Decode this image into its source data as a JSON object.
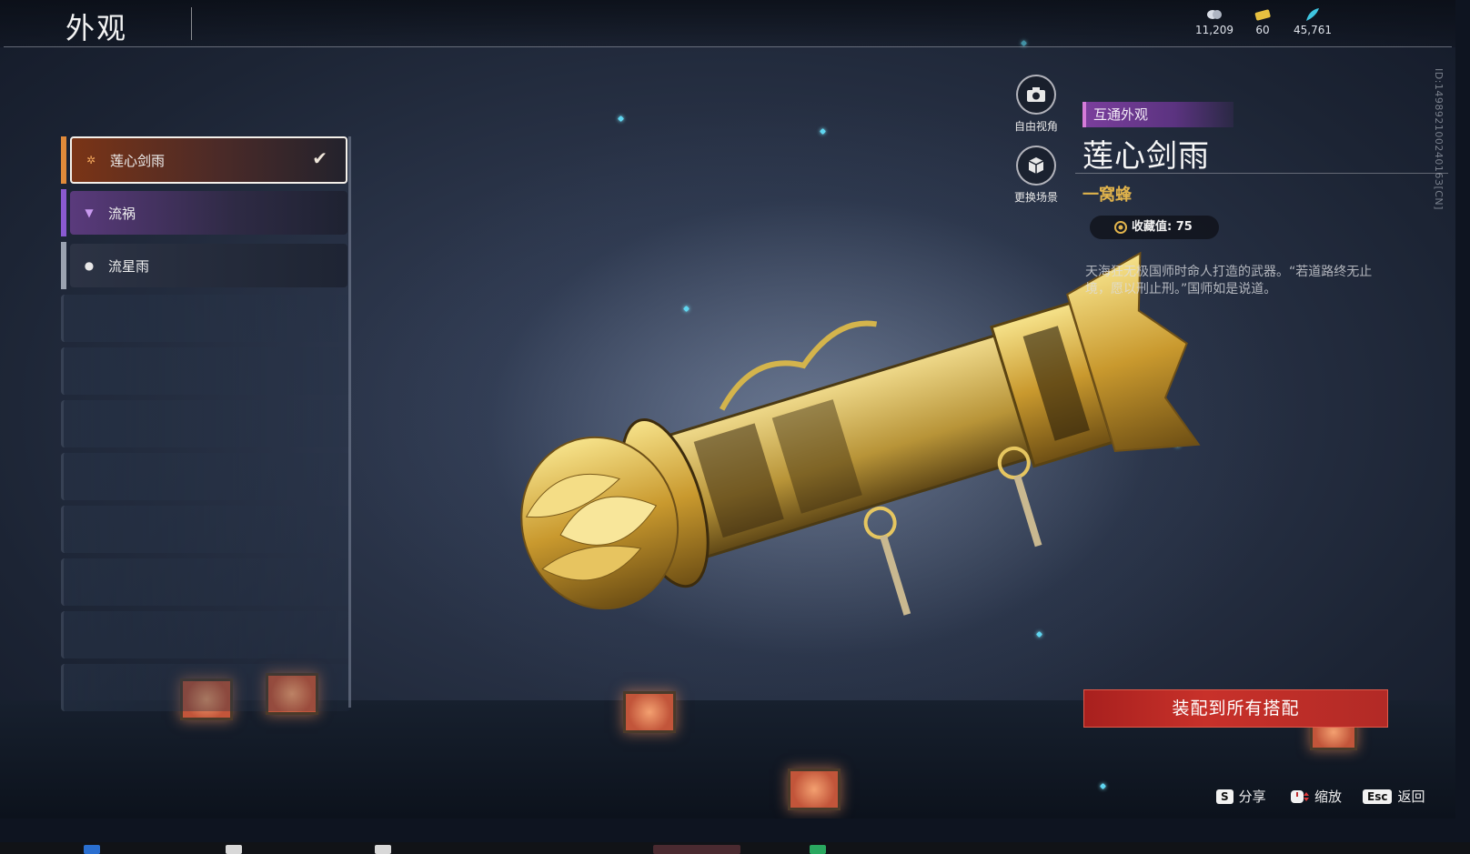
{
  "header": {
    "title": "外观",
    "currencies": [
      {
        "icon": "coin-icon",
        "value": "11,209",
        "color": "#d8dde6"
      },
      {
        "icon": "ticket-icon",
        "value": "60",
        "color": "#e6c040"
      },
      {
        "icon": "feather-icon",
        "value": "45,761",
        "color": "#3fc6e0"
      }
    ]
  },
  "side_id": "ID:14989210024016З[CN]",
  "skins": [
    {
      "name": "莲心剑雨",
      "icon": "lotus-icon",
      "selected": true,
      "rarity_color": "#e08a3a"
    },
    {
      "name": "流祸",
      "icon": "trident-icon",
      "selected": false,
      "rarity_color": "#8a5ad0"
    },
    {
      "name": "流星雨",
      "icon": "drop-icon",
      "selected": false,
      "rarity_color": "#9aa2b0"
    }
  ],
  "camera": {
    "free_view_label": "自由视角",
    "change_scene_label": "更换场景"
  },
  "detail": {
    "tag": "互通外观",
    "name": "莲心剑雨",
    "category": "一窝蜂",
    "collection": "收藏值: 75",
    "description": "天海狂无极国师时命人打造的武器。“若道路终无止境，愿以刑止刑。”国师如是说道。"
  },
  "actions": {
    "equip_all": "装配到所有搭配",
    "share_key": "S",
    "share": "分享",
    "zoom": "缩放",
    "back_key": "Esc",
    "back": "返回"
  }
}
